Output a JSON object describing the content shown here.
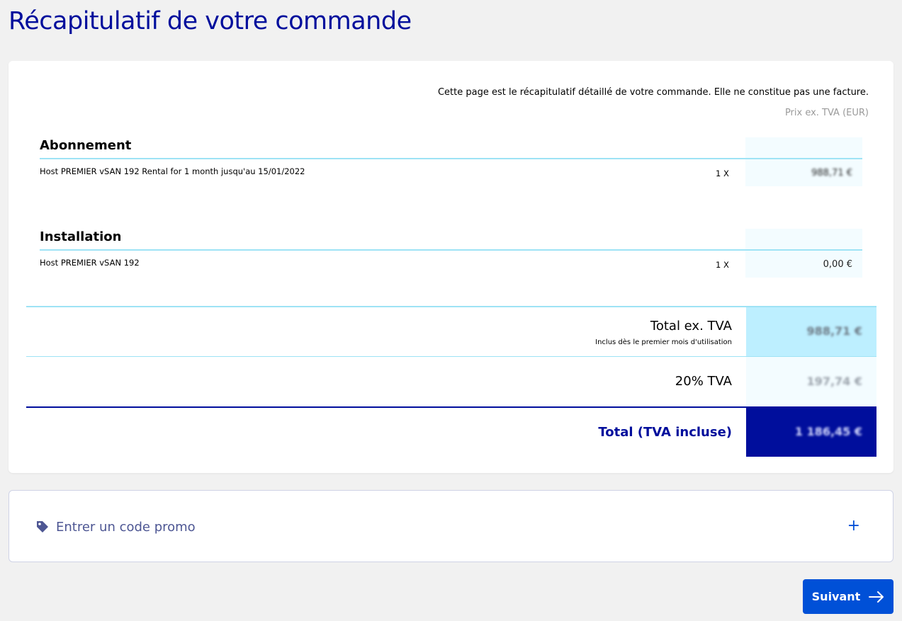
{
  "page": {
    "title": "Récapitulatif de votre commande"
  },
  "summary": {
    "disclaimer": "Cette page est le récapitulatif détaillé de votre commande. Elle ne constitue pas une facture.",
    "currency_note": "Prix ex. TVA (EUR)",
    "sections": [
      {
        "heading": "Abonnement",
        "item": "Host PREMIER vSAN 192 Rental for 1 month jusqu'au 15/01/2022",
        "quantity": "1 X",
        "price": "988,71 €"
      },
      {
        "heading": "Installation",
        "item": "Host PREMIER vSAN 192",
        "quantity": "1 X",
        "price": "0,00 €"
      }
    ],
    "totals": {
      "subtotal_label": "Total ex. TVA",
      "subtotal_note": "Inclus dès le premier mois d'utilisation",
      "subtotal_value": "988,71 €",
      "vat_label": "20% TVA",
      "vat_value": "197,74 €",
      "grand_total_label": "Total (TVA incluse)",
      "grand_total_value": "1 186,45 €"
    }
  },
  "promo": {
    "label": "Entrer un code promo",
    "icon": "tag-icon",
    "expand_icon": "plus-icon"
  },
  "actions": {
    "next_label": "Suivant"
  },
  "colors": {
    "primary": "#0050d7",
    "brand_dark": "#000e9c",
    "accent_light": "#bdefff"
  }
}
